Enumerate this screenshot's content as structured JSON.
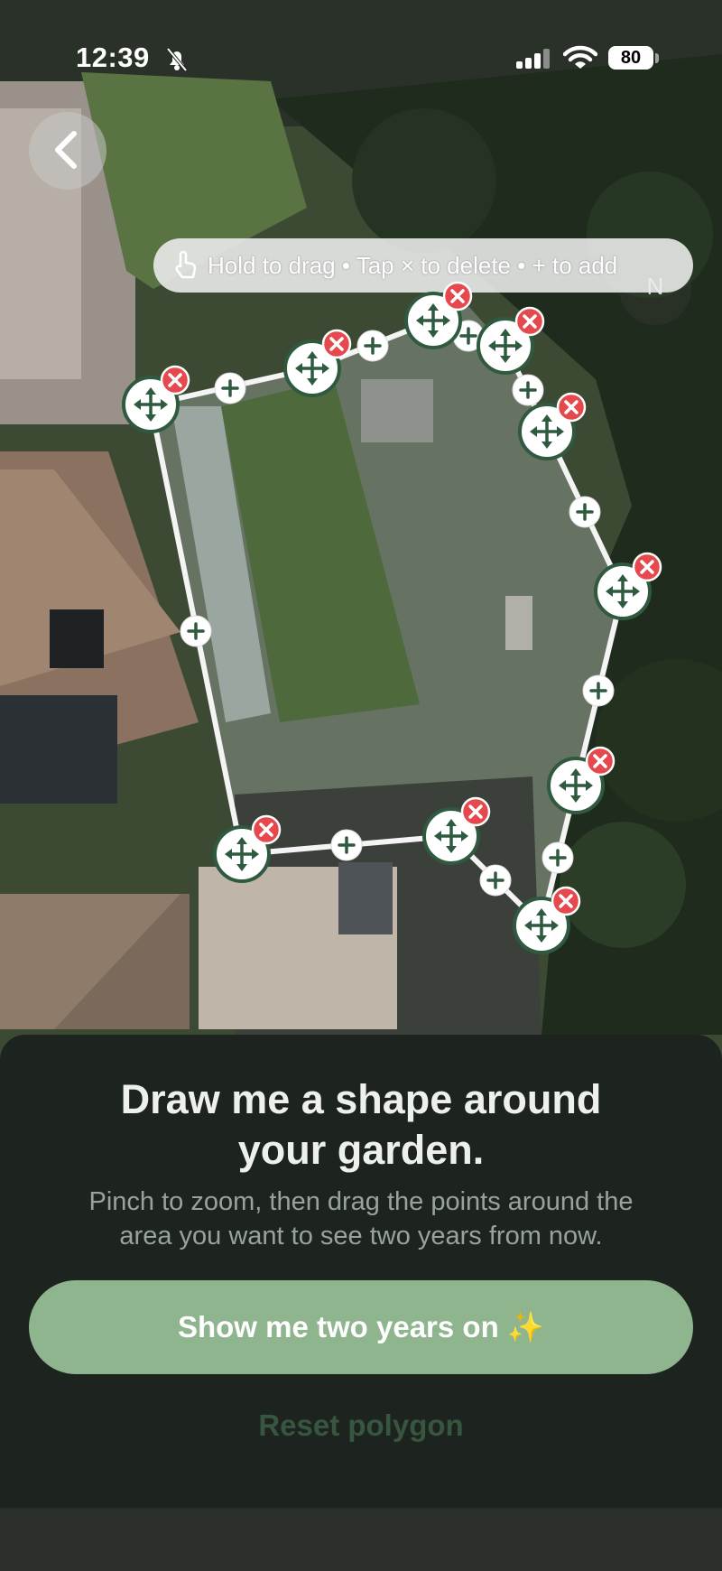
{
  "status_bar": {
    "time": "12:39",
    "battery": "80",
    "icons": [
      "bell-slash-icon",
      "cellular-signal-icon",
      "wifi-icon",
      "battery-icon"
    ]
  },
  "map": {
    "hint": "Hold to drag • Tap × to delete • + to add",
    "compass_label": "N",
    "back_icon": "chevron-left-icon",
    "hand_icon": "hand-pointer-icon",
    "drag_icon": "move-arrows-icon",
    "delete_icon": "close-icon",
    "add_icon": "plus-icon",
    "colors": {
      "polygon_edge": "#f4f4f4",
      "vertex_border": "#2f5a40",
      "vertex_fill": "#ffffff",
      "delete_badge": "#e5484d"
    }
  },
  "sheet": {
    "title_line1": "Draw me a shape around",
    "title_line2": "your garden.",
    "subtitle_line1": "Pinch to zoom, then drag the points around the",
    "subtitle_line2": "area you want to see two years from now.",
    "primary_button": "Show me two years on ✨",
    "reset_button": "Reset polygon",
    "colors": {
      "background": "#1d2420",
      "primary_button": "#8fb58f",
      "reset_text": "#38553f"
    }
  }
}
